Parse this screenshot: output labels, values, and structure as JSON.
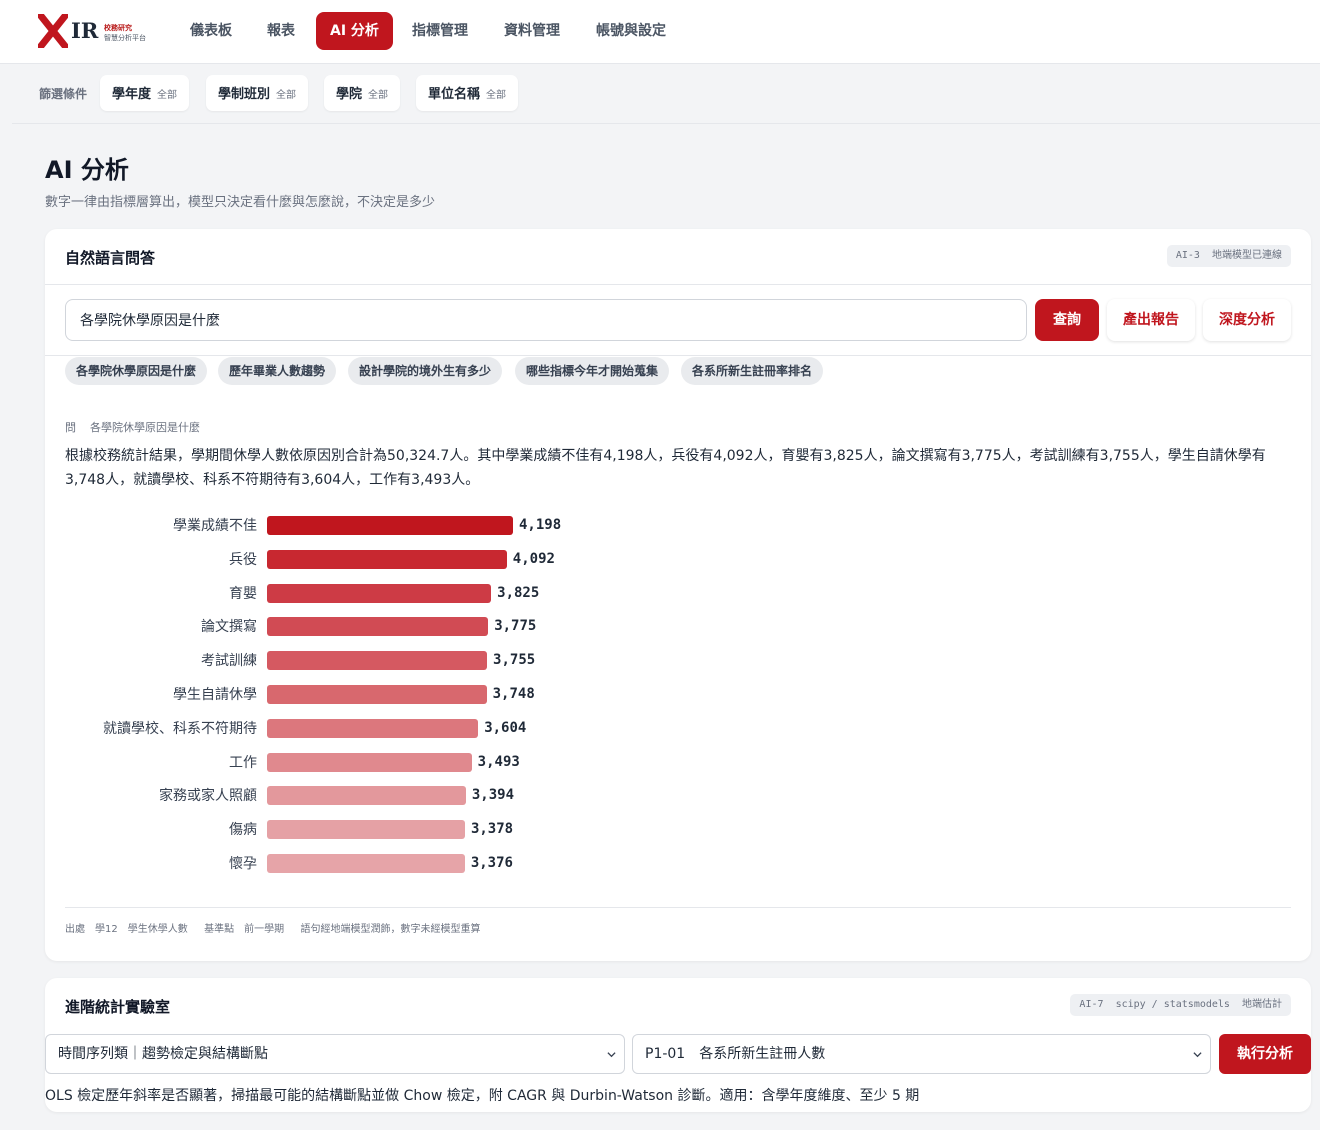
{
  "app": {
    "logo_text": "IR",
    "logo_sub1": "校務研究",
    "logo_sub2": "智慧分析平台"
  },
  "nav": [
    {
      "label": "儀表板",
      "active": false
    },
    {
      "label": "報表",
      "active": false
    },
    {
      "label": "AI 分析",
      "active": true
    },
    {
      "label": "指標管理",
      "active": false
    },
    {
      "label": "資料管理",
      "active": false
    },
    {
      "label": "帳號與設定",
      "active": false
    }
  ],
  "filters": {
    "label": "篩選條件",
    "chips": [
      {
        "name": "學年度",
        "value": "全部"
      },
      {
        "name": "學制班別",
        "value": "全部"
      },
      {
        "name": "學院",
        "value": "全部"
      },
      {
        "name": "單位名稱",
        "value": "全部"
      }
    ]
  },
  "page": {
    "title": "AI 分析",
    "subtitle": "數字一律由指標層算出，模型只決定看什麼與怎麼說，不決定是多少"
  },
  "qa": {
    "title": "自然語言問答",
    "badge_code": "AI-3",
    "badge_text": "地端模型已連線",
    "query_value": "各學院休學原因是什麼",
    "query_button": "查詢",
    "report_button": "產出報告",
    "deep_button": "深度分析",
    "suggestions": [
      "各學院休學原因是什麼",
      "歷年畢業人數趨勢",
      "設計學院的境外生有多少",
      "哪些指標今年才開始蒐集",
      "各系所新生註冊率排名"
    ],
    "question_prefix": "問",
    "question_text": "各學院休學原因是什麼",
    "answer_text": "根據校務統計結果，學期間休學人數依原因別合計為50,324.7人。其中學業成績不佳有4,198人，兵役有4,092人，育嬰有3,825人，論文撰寫有3,775人，考試訓練有3,755人，學生自請休學有3,748人，就讀學校、科系不符期待有3,604人，工作有3,493人。",
    "source_label": "出處",
    "source_code": "學12",
    "source_name": "學生休學人數",
    "baseline_label": "基準點",
    "baseline_value": "前一學期",
    "note": "語句經地端模型潤飾，數字未經模型重算"
  },
  "chart_data": {
    "type": "bar",
    "orientation": "horizontal",
    "categories": [
      "學業成績不佳",
      "兵役",
      "育嬰",
      "論文撰寫",
      "考試訓練",
      "學生自請休學",
      "就讀學校、科系不符期待",
      "工作",
      "家務或家人照顧",
      "傷病",
      "懷孕"
    ],
    "values": [
      4198,
      4092,
      3825,
      3775,
      3755,
      3748,
      3604,
      3493,
      3394,
      3378,
      3376
    ],
    "value_labels": [
      "4,198",
      "4,092",
      "3,825",
      "3,775",
      "3,755",
      "3,748",
      "3,604",
      "3,493",
      "3,394",
      "3,378",
      "3,376"
    ],
    "colors": [
      "#c0161e",
      "#c82830",
      "#cd3b45",
      "#d14b54",
      "#d55961",
      "#d8686e",
      "#dc777d",
      "#e0898e",
      "#e3989c",
      "#e5a1a5",
      "#e6a4a8"
    ]
  },
  "lab": {
    "title": "進階統計實驗室",
    "badge_code": "AI-7",
    "badge_text": "scipy / statsmodels",
    "badge_tail": "地端估計",
    "select_method": "時間序列類｜趨勢檢定與結構斷點",
    "select_indicator": "P1-01　各系所新生註冊人數",
    "run_button": "執行分析",
    "description": "OLS 檢定歷年斜率是否顯著，掃描最可能的結構斷點並做 Chow 檢定，附 CAGR 與 Durbin-Watson 診斷。適用：含學年度維度、至少 5 期"
  }
}
